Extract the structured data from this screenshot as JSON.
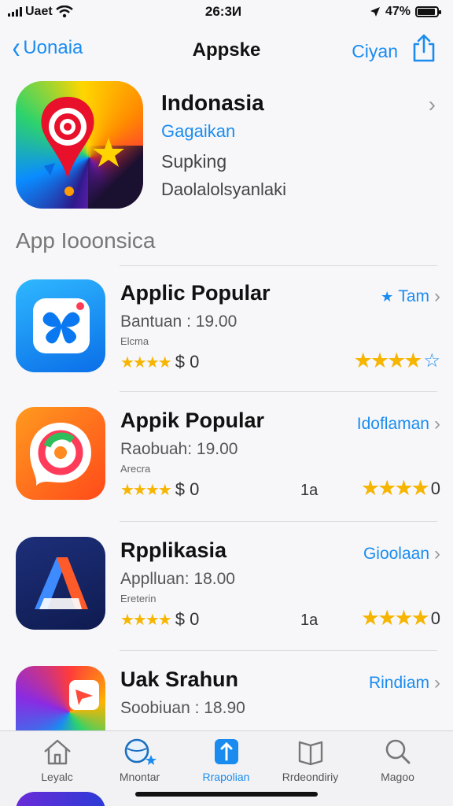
{
  "status_bar": {
    "carrier": "Uaet",
    "time": "26:3И",
    "battery": "47%",
    "battery_level": 0.9
  },
  "nav": {
    "back_label": "Uonaia",
    "title": "Appske",
    "action_label": "Ciyan"
  },
  "hero": {
    "name": "Indonasia",
    "subtitle": "Gagaikan",
    "line3": "Supking",
    "line4": "Daolalolsyanlaki"
  },
  "section_title": "App Iooonsica",
  "apps": [
    {
      "name": "Applic Popular",
      "price": "Bantuan : 19.00",
      "small": "Elcma",
      "price_label": "$ 0",
      "count": "",
      "link": "Tam",
      "link_spark": "★",
      "rating": 3.5,
      "right_suffix": ""
    },
    {
      "name": "Appik Popular",
      "price": "Raobuah: 19.00",
      "small": "Arecra",
      "price_label": "$ 0",
      "count": "1a",
      "link": "Idoflaman",
      "link_spark": "",
      "rating": 3.5,
      "right_suffix": "0"
    },
    {
      "name": "Rpplikasia",
      "price": "Applluan: 18.00",
      "small": "Ereterin",
      "price_label": "$ 0",
      "count": "1a",
      "link": "Gioolaan",
      "link_spark": "",
      "rating": 4,
      "right_suffix": "0"
    },
    {
      "name": "Uak Srahun",
      "price": "Soobiuan : 18.90",
      "small": "",
      "price_label": "",
      "count": "",
      "link": "Rindiam",
      "link_spark": "",
      "rating": 0,
      "right_suffix": ""
    }
  ],
  "tabs": [
    {
      "label": "Leyalc",
      "icon": "home-icon"
    },
    {
      "label": "Mnontar",
      "icon": "globe-search-icon"
    },
    {
      "label": "Rrapolian",
      "icon": "bookmark-icon"
    },
    {
      "label": "Rrdeondiriy",
      "icon": "book-icon"
    },
    {
      "label": "Magoo",
      "icon": "search-icon"
    }
  ],
  "colors": {
    "accent": "#1a8cf0",
    "star": "#f6b500"
  }
}
